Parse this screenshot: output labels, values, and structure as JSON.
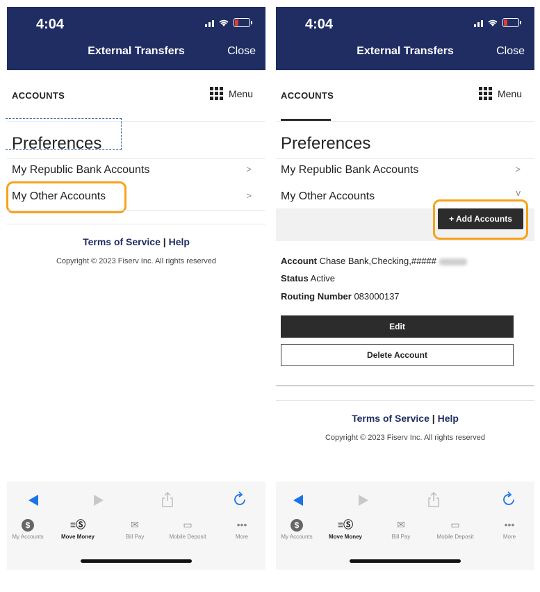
{
  "status": {
    "time": "4:04"
  },
  "header": {
    "title": "External Transfers",
    "close": "Close"
  },
  "nav": {
    "accounts_tab": "ACCOUNTS",
    "menu": "Menu"
  },
  "page": {
    "title": "Preferences"
  },
  "items": {
    "republic": "My Republic Bank Accounts",
    "other": "My Other Accounts",
    "chevron": ">",
    "chevron_down": "v"
  },
  "actions": {
    "add_accounts": "+ Add Accounts",
    "edit": "Edit",
    "delete": "Delete Account"
  },
  "account": {
    "account_label": "Account",
    "account_value": "Chase Bank,Checking,#####",
    "status_label": "Status",
    "status_value": "Active",
    "routing_label": "Routing Number",
    "routing_value": "083000137"
  },
  "footer": {
    "terms": "Terms of Service",
    "sep": "|",
    "help": "Help",
    "copyright": "Copyright © 2023 Fiserv Inc. All rights reserved"
  },
  "tabbar": {
    "my_accounts": "My Accounts",
    "move_money": "Move Money",
    "bill_pay": "Bill Pay",
    "mobile_deposit": "Mobile Deposit",
    "more": "More",
    "active": "Move Money"
  },
  "colors": {
    "header_bg": "#1f2d63",
    "highlight": "#f7a21b",
    "link": "#1f2d63",
    "button_dark": "#2c2c2c",
    "browser_blue": "#1a73e8"
  },
  "icons": [
    "grid-icon",
    "chevron-right-icon",
    "chevron-down-icon",
    "back-arrow-icon",
    "forward-arrow-icon",
    "share-icon",
    "reload-icon",
    "dollar-coin-icon",
    "move-money-icon",
    "bill-pay-icon",
    "mobile-deposit-icon",
    "more-icon",
    "signal-icon",
    "wifi-icon",
    "battery-icon"
  ]
}
